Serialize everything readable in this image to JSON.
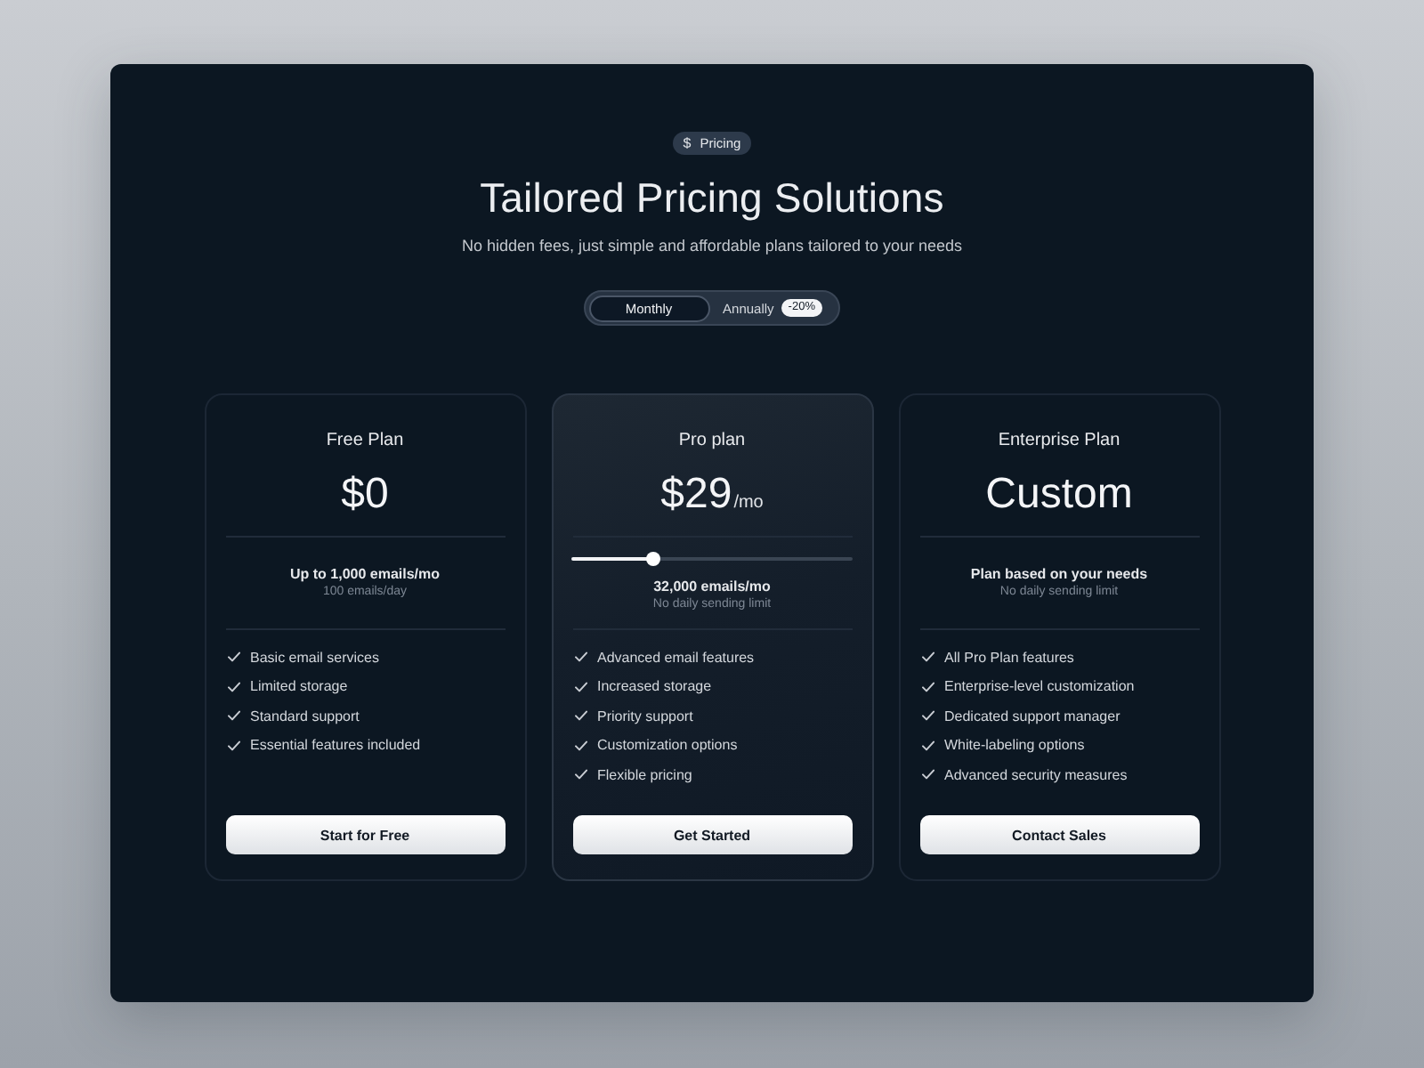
{
  "header": {
    "badge": {
      "symbol": "$",
      "label": "Pricing"
    },
    "title": "Tailored Pricing Solutions",
    "subtitle": "No hidden fees, just simple and affordable plans tailored to your needs"
  },
  "billing": {
    "options": [
      {
        "label": "Monthly",
        "selected": true
      },
      {
        "label": "Annually",
        "selected": false,
        "discount": "-20%"
      }
    ]
  },
  "plans": [
    {
      "name": "Free Plan",
      "price": "$0",
      "highlighted": false,
      "limit": "Up to 1,000 emails/mo",
      "note": "100 emails/day",
      "features": [
        "Basic email services",
        "Limited storage",
        "Standard support",
        "Essential features included"
      ],
      "button": "Start for Free"
    },
    {
      "name": "Pro plan",
      "price": "$29",
      "period": "/mo",
      "highlighted": true,
      "slider": {
        "level": 0.29
      },
      "limit": "32,000 emails/mo",
      "note": "No daily sending limit",
      "features": [
        "Advanced email features",
        "Increased storage",
        "Priority support",
        "Customization options",
        "Flexible pricing"
      ],
      "button": "Get Started"
    },
    {
      "name": "Enterprise Plan",
      "price": "Custom",
      "highlighted": false,
      "limit": "Plan based on your needs",
      "note": "No daily sending limit",
      "features": [
        "All Pro Plan features",
        "Enterprise-level customization",
        "Dedicated support manager",
        "White-labeling options",
        "Advanced security measures"
      ],
      "button": "Contact Sales"
    }
  ]
}
